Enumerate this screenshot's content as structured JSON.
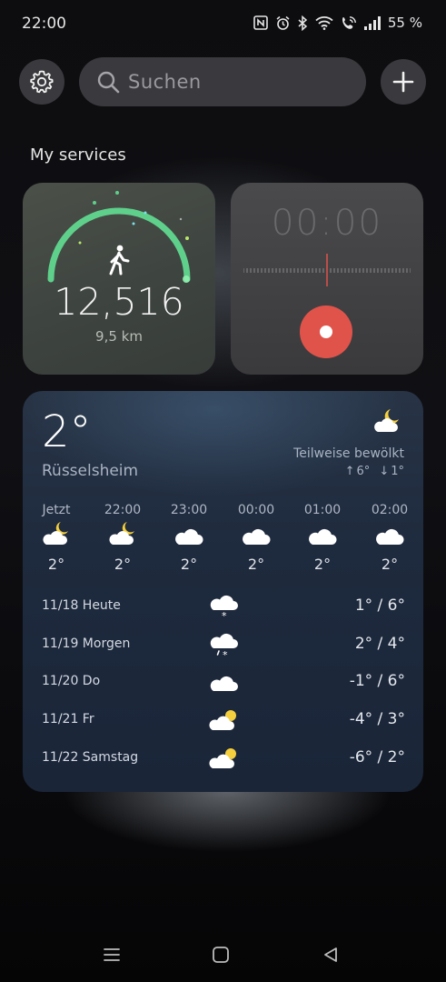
{
  "status": {
    "time": "22:00",
    "battery": "55 %"
  },
  "search": {
    "placeholder": "Suchen"
  },
  "section_title": "My services",
  "steps": {
    "count": "12,516",
    "distance": "9,5 km"
  },
  "recorder": {
    "time": "00:00"
  },
  "weather": {
    "temp": "2°",
    "city": "Rüsselsheim",
    "condition": "Teilweise bewölkt",
    "high": "6°",
    "low": "1°",
    "hourly": [
      {
        "time": "Jetzt",
        "temp": "2°",
        "icon": "partly-cloudy-night-icon"
      },
      {
        "time": "22:00",
        "temp": "2°",
        "icon": "partly-cloudy-night-icon"
      },
      {
        "time": "23:00",
        "temp": "2°",
        "icon": "cloud-icon"
      },
      {
        "time": "00:00",
        "temp": "2°",
        "icon": "cloud-icon"
      },
      {
        "time": "01:00",
        "temp": "2°",
        "icon": "cloud-icon"
      },
      {
        "time": "02:00",
        "temp": "2°",
        "icon": "cloud-icon"
      }
    ],
    "daily": [
      {
        "day": "11/18 Heute",
        "temps": "1° / 6°",
        "icon": "snow-icon"
      },
      {
        "day": "11/19 Morgen",
        "temps": "2° / 4°",
        "icon": "sleet-icon"
      },
      {
        "day": "11/20 Do",
        "temps": "-1° / 6°",
        "icon": "cloud-icon"
      },
      {
        "day": "11/21 Fr",
        "temps": "-4° / 3°",
        "icon": "partly-cloudy-day-icon"
      },
      {
        "day": "11/22 Samstag",
        "temps": "-6° / 2°",
        "icon": "partly-cloudy-day-icon"
      }
    ]
  },
  "colors": {
    "accent_green": "#5fd08b",
    "record_red": "#e0534a"
  }
}
